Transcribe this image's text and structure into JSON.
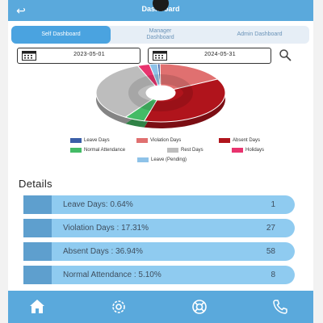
{
  "header": {
    "title": "Dashboard",
    "back_icon": "back-arrow-icon"
  },
  "tabs": [
    {
      "label": "Self Dashboard",
      "active": true
    },
    {
      "label": "Manager Dashboard",
      "active": false
    },
    {
      "label": "Admin Dashboard",
      "active": false
    }
  ],
  "filters": {
    "start_date": "2023-05-01",
    "end_date": "2024-05-31",
    "calendar_icon": "calendar-icon",
    "search_icon": "search-icon"
  },
  "chart_data": {
    "type": "pie",
    "labels": [
      "Leave Days",
      "Violation Days",
      "Absent Days",
      "Normal Attendance",
      "Rest Days",
      "Holidays",
      "Leave (Pending)"
    ],
    "values": [
      0.64,
      17.31,
      36.94,
      5.1,
      35.0,
      3.0,
      2.0
    ],
    "colors": [
      "#3b5fa8",
      "#e07070",
      "#b0141c",
      "#44bb66",
      "#bdbdbd",
      "#e8336e",
      "#8ec2e8"
    ]
  },
  "legend": [
    {
      "label": "Leave Days",
      "color": "#3b5fa8"
    },
    {
      "label": "Violation Days",
      "color": "#e07070"
    },
    {
      "label": "Absent Days",
      "color": "#b0141c"
    },
    {
      "label": "Normal Attendance",
      "color": "#44bb66"
    },
    {
      "label": "Rest Days",
      "color": "#bdbdbd"
    },
    {
      "label": "Holidays",
      "color": "#e8336e"
    },
    {
      "label": "Leave (Pending)",
      "color": "#8ec2e8"
    }
  ],
  "details": {
    "title": "Details",
    "rows": [
      {
        "label": "Leave Days:  0.64%",
        "count": "1"
      },
      {
        "label": "Violation Days :  17.31%",
        "count": "27"
      },
      {
        "label": "Absent Days :  36.94%",
        "count": "58"
      },
      {
        "label": "Normal Attendance :  5.10%",
        "count": "8"
      }
    ]
  },
  "nav": [
    {
      "name": "home-icon"
    },
    {
      "name": "settings-icon"
    },
    {
      "name": "support-icon"
    },
    {
      "name": "phone-icon"
    }
  ],
  "colors": {
    "primary": "#5aa9dc",
    "tab_active": "#4aa3e0",
    "row_bg": "#8fcbf0",
    "row_accent": "#5e9fce"
  }
}
